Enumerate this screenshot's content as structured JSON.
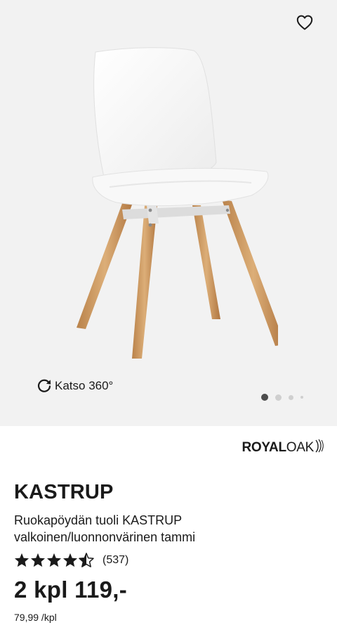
{
  "hero": {
    "view360_label": "Katso 360°",
    "carousel_dots": [
      {
        "active": true,
        "size": "large"
      },
      {
        "active": false,
        "size": "medium"
      },
      {
        "active": false,
        "size": "small"
      },
      {
        "active": false,
        "size": "tiny"
      }
    ],
    "icons": {
      "favorite": "heart-outline-icon",
      "rotate": "rotate-cw-icon"
    }
  },
  "brand": {
    "part1": "ROYAL",
    "part2": "OAK"
  },
  "product": {
    "name": "KASTRUP",
    "description_line1": "Ruokapöydän tuoli KASTRUP",
    "description_line2": "valkoinen/luonnonvärinen tammi",
    "rating": 4.5,
    "rating_max": 5,
    "review_count": "(537)",
    "price": "2 kpl 119,-",
    "unit_price": "79,99 /kpl"
  },
  "colors": {
    "hero_bg": "#f2f2f2",
    "text": "#1a1a1a",
    "dot_active": "#4d4d4d",
    "dot_inactive": "#cfcfcf"
  }
}
